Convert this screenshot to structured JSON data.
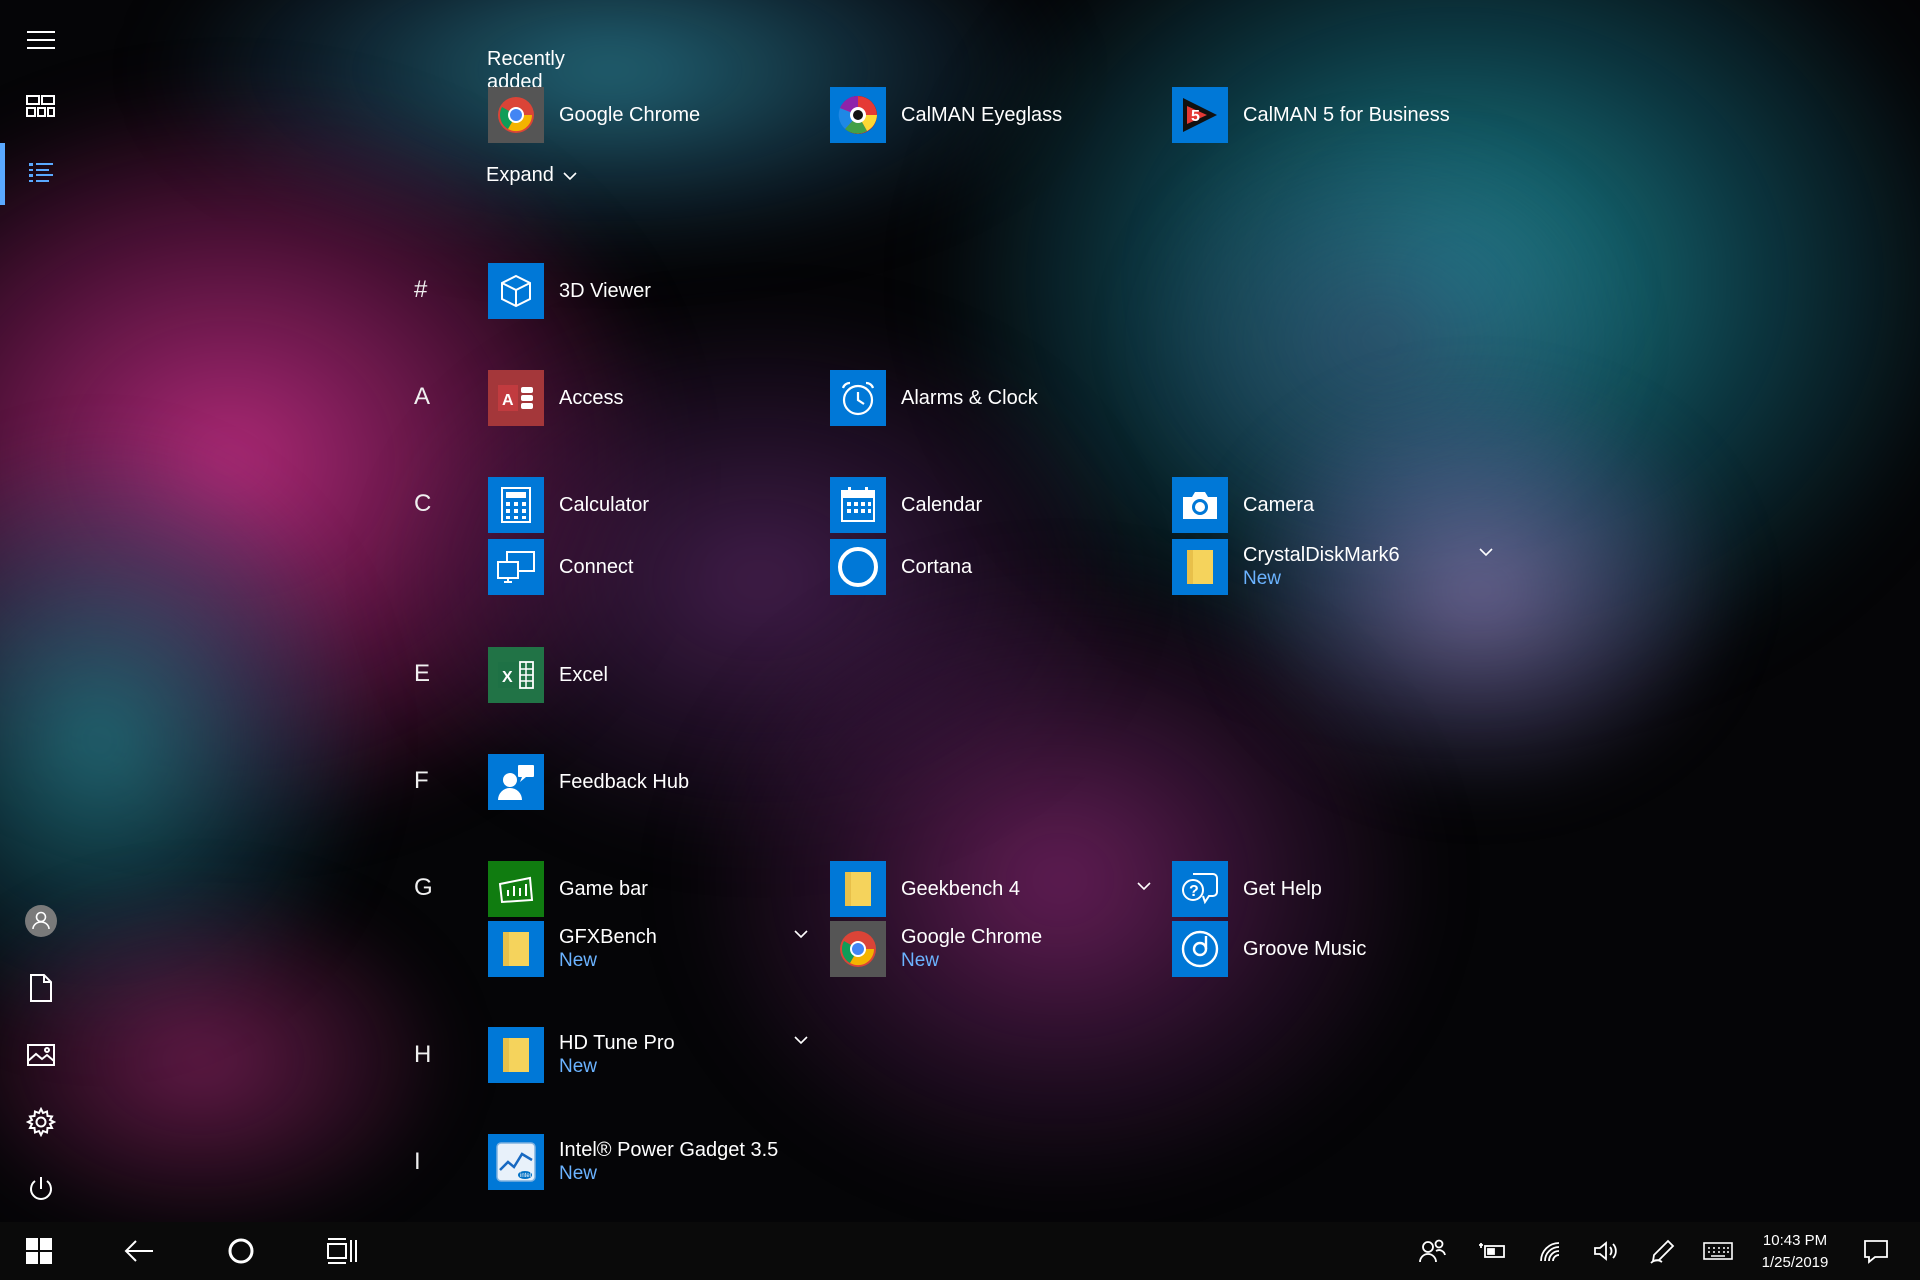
{
  "recently_added": {
    "title": "Recently added",
    "expand_label": "Expand",
    "apps": [
      {
        "name": "Google Chrome",
        "icon": "chrome-icon"
      },
      {
        "name": "CalMAN Eyeglass",
        "icon": "calman-eyeglass-icon"
      },
      {
        "name": "CalMAN 5 for Business",
        "icon": "calman5-icon"
      }
    ]
  },
  "groups": [
    {
      "letter": "#",
      "apps": [
        {
          "name": "3D Viewer",
          "icon": "cube-icon"
        }
      ]
    },
    {
      "letter": "A",
      "apps": [
        {
          "name": "Access",
          "icon": "access-icon"
        },
        {
          "name": "Alarms & Clock",
          "icon": "alarm-clock-icon"
        }
      ]
    },
    {
      "letter": "C",
      "apps": [
        {
          "name": "Calculator",
          "icon": "calculator-icon"
        },
        {
          "name": "Calendar",
          "icon": "calendar-icon"
        },
        {
          "name": "Camera",
          "icon": "camera-icon"
        },
        {
          "name": "Connect",
          "icon": "connect-icon"
        },
        {
          "name": "Cortana",
          "icon": "cortana-icon"
        },
        {
          "name": "CrystalDiskMark6",
          "icon": "folder-icon",
          "badge": "New"
        }
      ]
    },
    {
      "letter": "E",
      "apps": [
        {
          "name": "Excel",
          "icon": "excel-icon"
        }
      ]
    },
    {
      "letter": "F",
      "apps": [
        {
          "name": "Feedback Hub",
          "icon": "feedback-icon"
        }
      ]
    },
    {
      "letter": "G",
      "apps": [
        {
          "name": "Game bar",
          "icon": "game-bar-icon"
        },
        {
          "name": "Geekbench 4",
          "icon": "folder-icon"
        },
        {
          "name": "Get Help",
          "icon": "get-help-icon"
        },
        {
          "name": "GFXBench",
          "icon": "folder-icon",
          "badge": "New"
        },
        {
          "name": "Google Chrome",
          "icon": "chrome-icon",
          "badge": "New"
        },
        {
          "name": "Groove Music",
          "icon": "groove-icon"
        }
      ]
    },
    {
      "letter": "H",
      "apps": [
        {
          "name": "HD Tune Pro",
          "icon": "folder-icon",
          "badge": "New"
        }
      ]
    },
    {
      "letter": "I",
      "apps": [
        {
          "name": "Intel® Power Gadget 3.5",
          "icon": "intel-gadget-icon",
          "badge": "New"
        }
      ]
    }
  ],
  "sidebar": {
    "items": [
      "menu-icon",
      "tiles-icon",
      "all-apps-icon",
      "user-icon",
      "documents-icon",
      "pictures-icon",
      "settings-icon",
      "power-icon"
    ]
  },
  "taskbar": {
    "time": "10:43 PM",
    "date": "1/25/2019",
    "tray_icons": [
      "people-icon",
      "battery-icon",
      "wifi-icon",
      "volume-icon",
      "pen-icon",
      "keyboard-icon",
      "action-center-icon"
    ]
  },
  "colors": {
    "accent": "#0078d7",
    "new_badge": "#6bb3ff",
    "active_indicator": "#5aa9ff"
  }
}
